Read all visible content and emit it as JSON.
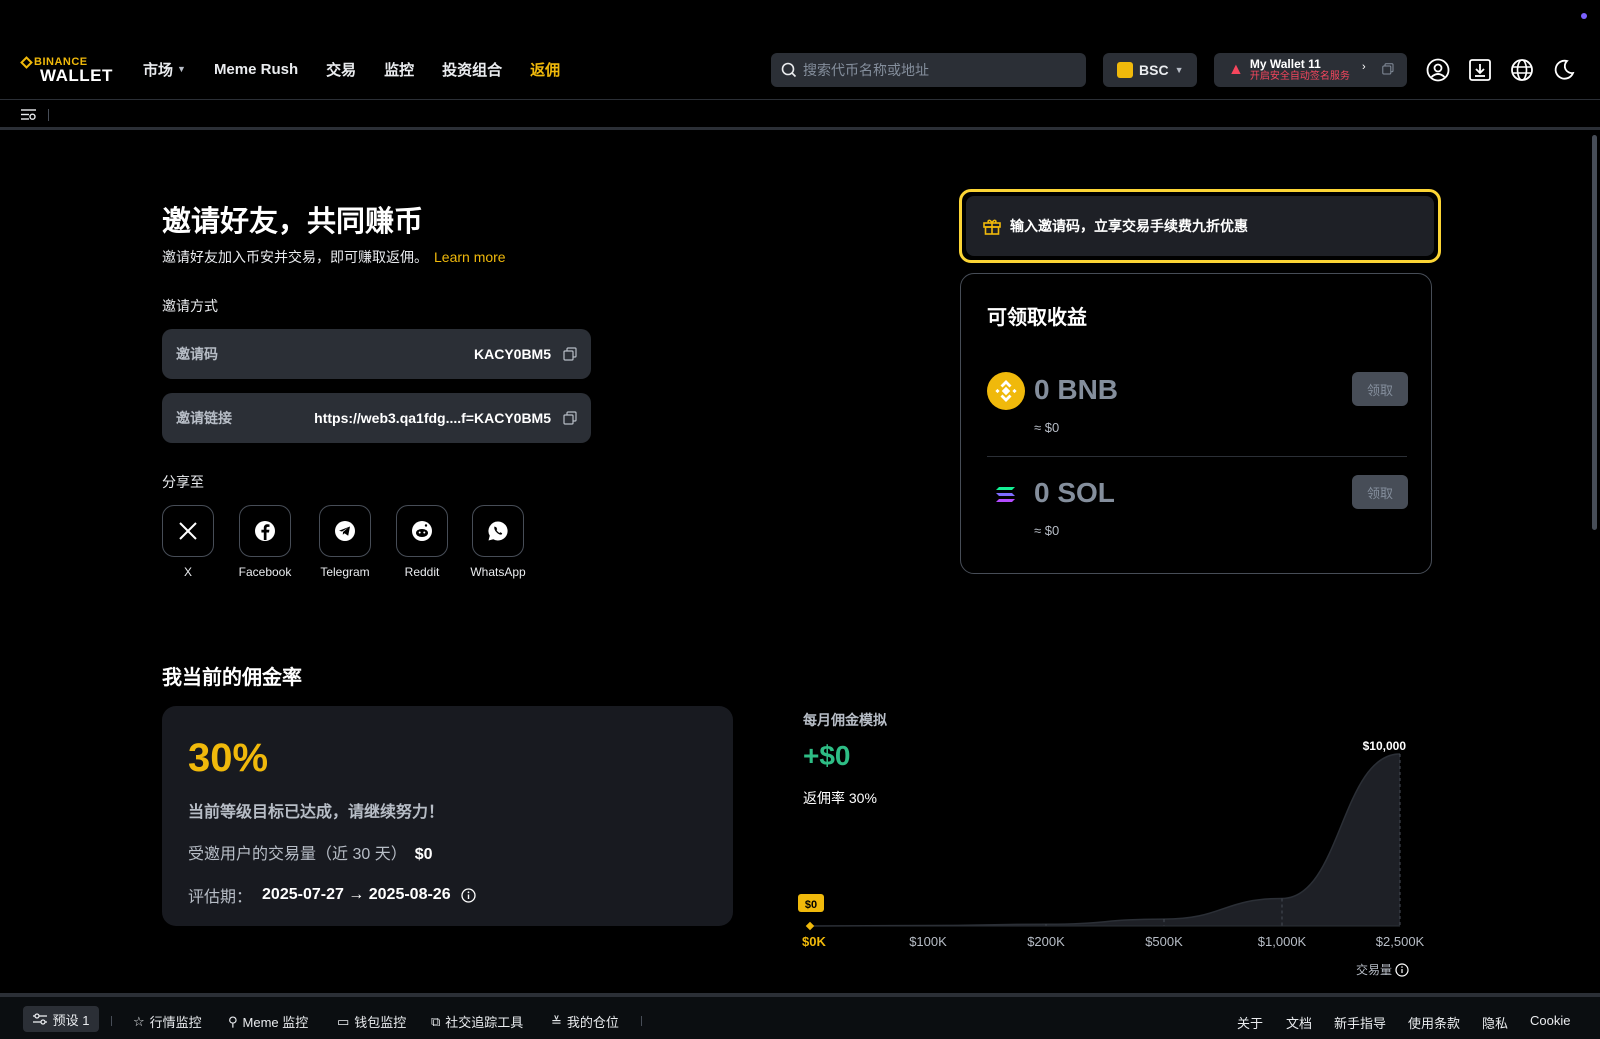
{
  "header": {
    "logo_top": "BINANCE",
    "logo_bottom": "WALLET",
    "nav": [
      {
        "label": "市场",
        "has_chevron": true
      },
      {
        "label": "Meme Rush"
      },
      {
        "label": "交易"
      },
      {
        "label": "监控"
      },
      {
        "label": "投资组合"
      },
      {
        "label": "返佣",
        "active": true
      }
    ],
    "search_placeholder": "搜索代币名称或地址",
    "chain_label": "BSC",
    "wallet_name": "My Wallet 11",
    "wallet_warning": "开启安全自动签名服务"
  },
  "invite": {
    "title": "邀请好友，共同赚币",
    "subtitle": "邀请好友加入币安并交易，即可赚取返佣。",
    "learn_more": "Learn more",
    "method_label": "邀请方式",
    "code_label": "邀请码",
    "code_value": "KACY0BM5",
    "link_label": "邀请链接",
    "link_value": "https://web3.qa1fdg....f=KACY0BM5",
    "share_label": "分享至",
    "share": [
      {
        "name": "X",
        "icon": "x-icon"
      },
      {
        "name": "Facebook",
        "icon": "facebook-icon"
      },
      {
        "name": "Telegram",
        "icon": "telegram-icon"
      },
      {
        "name": "Reddit",
        "icon": "reddit-icon"
      },
      {
        "name": "WhatsApp",
        "icon": "whatsapp-icon"
      }
    ]
  },
  "promo": {
    "text": "输入邀请码，立享交易手续费九折优惠"
  },
  "earnings": {
    "title": "可领取收益",
    "assets": [
      {
        "amount": "0 BNB",
        "usd": "≈ $0",
        "claim": "领取",
        "color": "#f0b90b"
      },
      {
        "amount": "0 SOL",
        "usd": "≈ $0",
        "claim": "领取",
        "color": "#9945ff"
      }
    ]
  },
  "rate": {
    "title": "我当前的佣金率",
    "percent": "30%",
    "message": "当前等级目标已达成，请继续努力！",
    "volume_label": "受邀用户的交易量（近 30 天）",
    "volume_value": "$0",
    "period_label": "评估期：",
    "period_value": "2025-07-27 → 2025-08-26"
  },
  "simulation": {
    "label": "每月佣金模拟",
    "value": "+$0",
    "rate_text": "返佣率 30%",
    "axis_title": "交易量",
    "max_label": "$10,000",
    "current_label": "$0"
  },
  "chart_data": {
    "type": "area",
    "x": [
      "$0K",
      "$100K",
      "$200K",
      "$500K",
      "$1,000K",
      "$2,500K"
    ],
    "values": [
      0,
      30,
      100,
      400,
      1600,
      10000
    ],
    "xlabel": "交易量",
    "ylim": [
      0,
      10000
    ],
    "highlight_index": 0,
    "colors": {
      "fill": "#1e2026",
      "line": "#2b2f36",
      "marker": "#f0b90b"
    }
  },
  "footer": {
    "preset": "预设 1",
    "items": [
      {
        "label": "行情监控",
        "icon": "star-icon"
      },
      {
        "label": "Meme 监控",
        "icon": "meme-icon"
      },
      {
        "label": "钱包监控",
        "icon": "wallet-icon"
      },
      {
        "label": "社交追踪工具",
        "icon": "social-icon"
      },
      {
        "label": "我的仓位",
        "icon": "position-icon"
      }
    ],
    "links": [
      "关于",
      "文档",
      "新手指导",
      "使用条款",
      "隐私",
      "Cookie"
    ]
  }
}
